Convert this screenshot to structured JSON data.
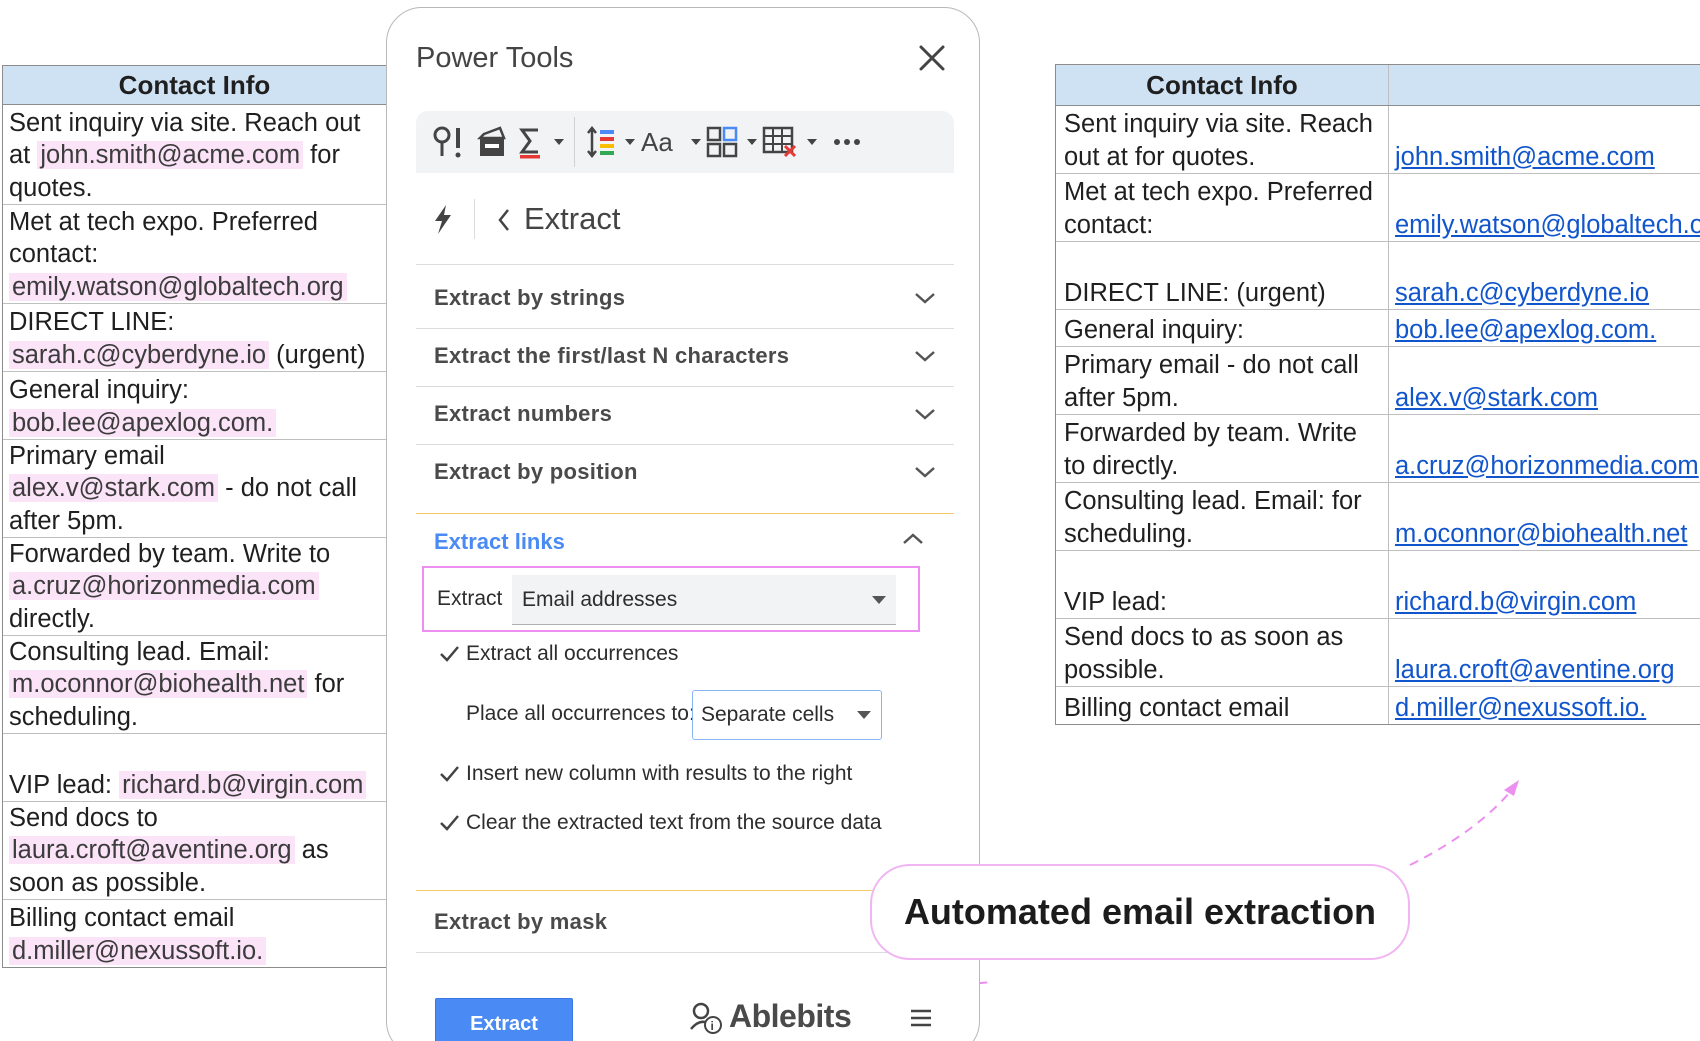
{
  "left_table": {
    "header": "Contact Info",
    "rows": [
      {
        "before": "Sent inquiry via site. Reach out at ",
        "email": "john.smith@acme.com",
        "after": " for quotes."
      },
      {
        "before": "Met at tech expo. Preferred contact: ",
        "email": "emily.watson@globaltech.org",
        "after": ""
      },
      {
        "before": "DIRECT LINE: ",
        "email": "sarah.c@cyberdyne.io",
        "after": " (urgent)"
      },
      {
        "before": "General inquiry: ",
        "email": "bob.lee@apexlog.com.",
        "after": ""
      },
      {
        "before": "Primary email ",
        "email": "alex.v@stark.com",
        "after": " - do not call after 5pm."
      },
      {
        "before": "Forwarded by team. Write to ",
        "email": "a.cruz@horizonmedia.com",
        "after": " directly."
      },
      {
        "before": "Consulting lead. Email: ",
        "email": "m.oconnor@biohealth.net",
        "after": " for scheduling."
      },
      {
        "before": "VIP lead: ",
        "email": "richard.b@virgin.com",
        "after": ""
      },
      {
        "before": "Send docs to ",
        "email": "laura.croft@aventine.org",
        "after": " as soon as possible."
      },
      {
        "before": "Billing contact email ",
        "email": "d.miller@nexussoft.io.",
        "after": ""
      }
    ]
  },
  "right_table": {
    "header": "Contact Info",
    "rows": [
      {
        "text": "Sent inquiry via site. Reach out at  for quotes.",
        "email": "john.smith@acme.com"
      },
      {
        "text": "Met at tech expo. Preferred contact:",
        "email": "emily.watson@globaltech.org"
      },
      {
        "text": "DIRECT LINE:  (urgent)",
        "email": "sarah.c@cyberdyne.io"
      },
      {
        "text": "General inquiry:",
        "email": "bob.lee@apexlog.com."
      },
      {
        "text": "Primary email  - do not call after 5pm.",
        "email": "alex.v@stark.com"
      },
      {
        "text": "Forwarded by team. Write to  directly.",
        "email": "a.cruz@horizonmedia.com"
      },
      {
        "text": "Consulting lead. Email:  for scheduling.",
        "email": "m.oconnor@biohealth.net"
      },
      {
        "text": "VIP lead:",
        "email": "richard.b@virgin.com"
      },
      {
        "text": "Send docs to  as soon as possible.",
        "email": "laura.croft@aventine.org"
      },
      {
        "text": "Billing contact email",
        "email": "d.miller@nexussoft.io."
      }
    ]
  },
  "panel": {
    "title": "Power Tools",
    "toolbar_icons": [
      "find-replace-icon",
      "data-icon",
      "sum-icon",
      "text-spacing-icon",
      "text-case-icon",
      "merge-icon",
      "clear-table-icon",
      "more-icon"
    ],
    "breadcrumb": "Extract",
    "sections": {
      "by_strings": "Extract by strings",
      "first_last": "Extract the first/last N characters",
      "numbers": "Extract numbers",
      "by_position": "Extract by position",
      "links": "Extract links",
      "by_mask": "Extract by mask"
    },
    "links_options": {
      "extract_label": "Extract",
      "extract_value": "Email addresses",
      "all_occurrences": "Extract all occurrences",
      "place_label": "Place all occurrences to:",
      "place_value": "Separate cells",
      "insert_column": "Insert new column with results to the right",
      "clear_source": "Clear the extracted text from the source data"
    },
    "extract_button": "Extract",
    "brand": "Ablebits"
  },
  "callout": "Automated email extraction",
  "colors": {
    "header_bg": "#cfe2f3",
    "email_highlight": "#fbe3f8",
    "link": "#1155cc",
    "accent_blue": "#4a8af4",
    "callout_border": "#f1b5f3"
  }
}
